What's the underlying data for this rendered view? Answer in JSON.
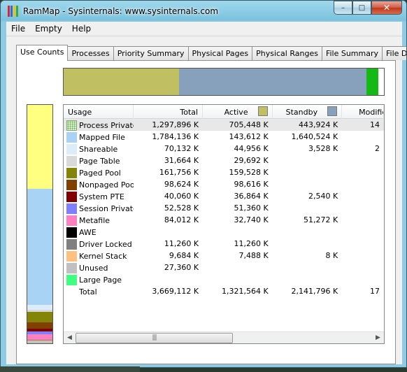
{
  "window": {
    "title": "RamMap - Sysinternals: www.sysinternals.com"
  },
  "controls": {
    "minimize": "–",
    "maximize": "□",
    "close": "✕"
  },
  "icons": {
    "app": "rammap-bars-icon"
  },
  "menu": [
    "File",
    "Empty",
    "Help"
  ],
  "tabs": [
    "Use Counts",
    "Processes",
    "Priority Summary",
    "Physical Pages",
    "Physical Ranges",
    "File Summary",
    "File Details"
  ],
  "active_tab": "Use Counts",
  "colors": {
    "active": "#c0c062",
    "standby": "#87a0bc",
    "modified": "#16b816"
  },
  "columns": {
    "usage": "Usage",
    "total": "Total",
    "active": "Active",
    "standby": "Standby",
    "modified": "Modifie"
  },
  "rows": [
    {
      "usage": "Process Private",
      "color": "dotted",
      "total": "1,297,896 K",
      "active": "705,448 K",
      "standby": "443,924 K",
      "modified": "14"
    },
    {
      "usage": "Mapped File",
      "color": "#a9d3f5",
      "total": "1,784,136 K",
      "active": "143,612 K",
      "standby": "1,640,524 K",
      "modified": ""
    },
    {
      "usage": "Shareable",
      "color": "#dcecf9",
      "total": "70,132 K",
      "active": "44,956 K",
      "standby": "3,528 K",
      "modified": "2"
    },
    {
      "usage": "Page Table",
      "color": "#d9d9d9",
      "total": "31,664 K",
      "active": "29,692 K",
      "standby": "",
      "modified": ""
    },
    {
      "usage": "Paged Pool",
      "color": "#848408",
      "total": "161,756 K",
      "active": "159,528 K",
      "standby": "",
      "modified": ""
    },
    {
      "usage": "Nonpaged Pool",
      "color": "#804000",
      "total": "98,624 K",
      "active": "98,616 K",
      "standby": "",
      "modified": ""
    },
    {
      "usage": "System PTE",
      "color": "#800000",
      "total": "40,060 K",
      "active": "36,864 K",
      "standby": "2,540 K",
      "modified": ""
    },
    {
      "usage": "Session Private",
      "color": "#7f80ff",
      "total": "52,528 K",
      "active": "51,360 K",
      "standby": "",
      "modified": ""
    },
    {
      "usage": "Metafile",
      "color": "#ff80c0",
      "total": "84,012 K",
      "active": "32,740 K",
      "standby": "51,272 K",
      "modified": ""
    },
    {
      "usage": "AWE",
      "color": "#000000",
      "total": "",
      "active": "",
      "standby": "",
      "modified": ""
    },
    {
      "usage": "Driver Locked",
      "color": "#808080",
      "total": "11,260 K",
      "active": "11,260 K",
      "standby": "",
      "modified": ""
    },
    {
      "usage": "Kernel Stack",
      "color": "#ffc080",
      "total": "9,684 K",
      "active": "7,488 K",
      "standby": "8 K",
      "modified": ""
    },
    {
      "usage": "Unused",
      "color": "#c0c0c0",
      "total": "27,360 K",
      "active": "",
      "standby": "",
      "modified": ""
    },
    {
      "usage": "Large Page",
      "color": "#40ff80",
      "total": "",
      "active": "",
      "standby": "",
      "modified": ""
    },
    {
      "usage": "Total",
      "color": "",
      "total": "3,669,112 K",
      "active": "1,321,564 K",
      "standby": "2,141,796 K",
      "modified": "17"
    }
  ],
  "top_bar_segments": [
    {
      "name": "active",
      "color": "#c0c062",
      "fraction": 0.361
    },
    {
      "name": "standby",
      "color": "#87a0bc",
      "fraction": 0.584
    },
    {
      "name": "modified",
      "color": "#16b816",
      "fraction": 0.038
    }
  ],
  "left_bar_segments": [
    {
      "name": "process-private",
      "color": "#ffff80",
      "fraction": 0.353
    },
    {
      "name": "mapped-file",
      "color": "#a9d3f5",
      "fraction": 0.486
    },
    {
      "name": "shareable",
      "color": "#dcecf9",
      "fraction": 0.019
    },
    {
      "name": "page-table",
      "color": "#d9d9d9",
      "fraction": 0.009
    },
    {
      "name": "paged-pool",
      "color": "#848408",
      "fraction": 0.044
    },
    {
      "name": "nonpaged-pool",
      "color": "#804000",
      "fraction": 0.027
    },
    {
      "name": "system-pte",
      "color": "#800000",
      "fraction": 0.011
    },
    {
      "name": "session-private",
      "color": "#7f80ff",
      "fraction": 0.014
    },
    {
      "name": "metafile",
      "color": "#ff80c0",
      "fraction": 0.023
    },
    {
      "name": "driver-locked",
      "color": "#808080",
      "fraction": 0.003
    },
    {
      "name": "kernel-stack",
      "color": "#ffc080",
      "fraction": 0.003
    },
    {
      "name": "unused",
      "color": "#c0c0c0",
      "fraction": 0.007
    }
  ],
  "scroll": {
    "grip": "|||"
  }
}
